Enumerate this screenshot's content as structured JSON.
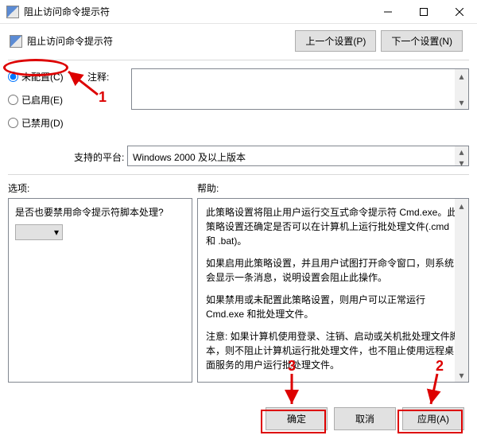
{
  "window": {
    "title": "阻止访问命令提示符"
  },
  "subheader": {
    "label": "阻止访问命令提示符",
    "prev": "上一个设置(P)",
    "next": "下一个设置(N)"
  },
  "radios": {
    "not_configured": "未配置(C)",
    "enabled": "已启用(E)",
    "disabled": "已禁用(D)",
    "selected": "not_configured"
  },
  "labels": {
    "comment": "注释:",
    "supported": "支持的平台:",
    "options": "选项:",
    "help": "帮助:"
  },
  "supported_text": "Windows 2000 及以上版本",
  "options_panel": {
    "question": "是否也要禁用命令提示符脚本处理?"
  },
  "help_panel": {
    "p1": "此策略设置将阻止用户运行交互式命令提示符 Cmd.exe。此策略设置还确定是否可以在计算机上运行批处理文件(.cmd 和 .bat)。",
    "p2": "如果启用此策略设置，并且用户试图打开命令窗口，则系统会显示一条消息，说明设置会阻止此操作。",
    "p3": "如果禁用或未配置此策略设置，则用户可以正常运行 Cmd.exe 和批处理文件。",
    "p4": "注意: 如果计算机使用登录、注销、启动或关机批处理文件脚本，则不阻止计算机运行批处理文件，也不阻止使用远程桌面服务的用户运行批处理文件。"
  },
  "buttons": {
    "ok": "确定",
    "cancel": "取消",
    "apply": "应用(A)"
  },
  "annotations": {
    "n1": "1",
    "n2": "2",
    "n3": "3"
  }
}
